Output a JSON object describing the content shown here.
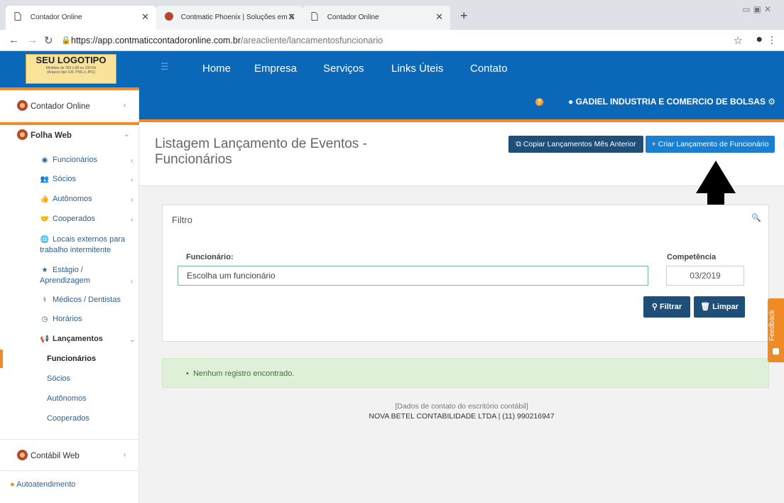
{
  "browser": {
    "tabs": [
      {
        "label": "Contador Online",
        "active": true
      },
      {
        "label": "Contmatic Phoenix | Soluções em S",
        "active": false
      },
      {
        "label": "Contador Online",
        "active": false
      }
    ],
    "new_tab_icon": "+",
    "url_host": "https://app.contmaticcontadoronline.com.br",
    "url_path": "/areacliente/lancamentosfuncionario"
  },
  "header": {
    "logo_title": "SEU LOGOTIPO",
    "logo_sub1": "Medidas de 250 x 68 ou 100 Kb",
    "logo_sub2": "(Arquivo tipo GIF, PNG e JPG)",
    "nav": [
      "Home",
      "Empresa",
      "Serviços",
      "Links Úteis",
      "Contato"
    ],
    "company": "GADIEL INDUSTRIA E COMERCIO DE BOLSAS",
    "accent": "#0b68b8",
    "accent2": "#f08a24"
  },
  "sidebar": {
    "contador_online": "Contador Online",
    "folha_web": "Folha Web",
    "items": [
      {
        "label": "Funcionários",
        "icon": "user-circle-icon"
      },
      {
        "label": "Sócios",
        "icon": "users-plus-icon"
      },
      {
        "label": "Autônomos",
        "icon": "thumbs-up-icon"
      },
      {
        "label": "Cooperados",
        "icon": "handshake-icon"
      },
      {
        "label": "Locais externos para trabalho intermitente",
        "icon": "globe-icon"
      },
      {
        "label": "Estágio / Aprendizagem",
        "icon": "star-icon"
      },
      {
        "label": "Médicos / Dentistas",
        "icon": "medic-icon"
      },
      {
        "label": "Horários",
        "icon": "clock-icon"
      },
      {
        "label": "Lançamentos",
        "icon": "megaphone-icon"
      }
    ],
    "lancamentos_sub": [
      "Funcionários",
      "Sócios",
      "Autônomos",
      "Cooperados"
    ],
    "contabil_web": "Contábil Web",
    "autoatendimento": "Autoatendimento"
  },
  "main": {
    "title": "Listagem Lançamento de Eventos - Funcionários",
    "copy_button": "Copiar Lançamentos Mês Anterior",
    "create_button": "Criar Lançamento de Funcionário",
    "filter_title": "Filtro",
    "employee_label": "Funcionário:",
    "employee_placeholder": "Escolha um funcionário",
    "competencia_label": "Competência",
    "competencia_value": "03/2019",
    "filter_button": "Filtrar",
    "clear_button": "Limpar",
    "no_records": "Nenhum registro encontrado.",
    "footer_line1": "[Dados de contato do escritório contábil]",
    "footer_line2": "NOVA BETEL CONTABILIDADE LTDA | (11) 990216947",
    "feedback": "Feedback"
  }
}
